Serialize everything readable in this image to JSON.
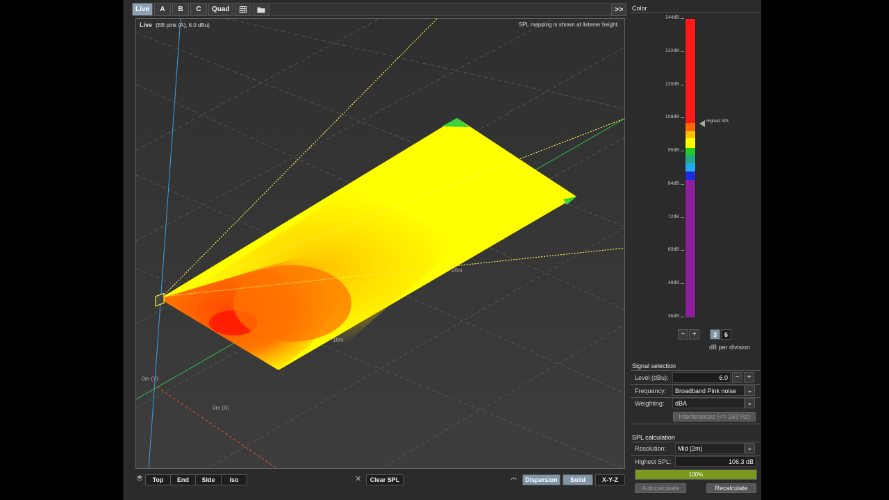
{
  "tabs": [
    {
      "label": "Live",
      "active": true
    },
    {
      "label": "A",
      "active": false
    },
    {
      "label": "B",
      "active": false
    },
    {
      "label": "C",
      "active": false
    },
    {
      "label": "Quad",
      "active": false
    }
  ],
  "toolbar": {
    "expand_label": ">>",
    "grid_icon": "table-icon",
    "folder_icon": "folder-icon"
  },
  "viewport": {
    "title": "Live",
    "signal_info": "(BB pink (A), 6.0 dBu)",
    "note": "SPL mapping is shown at listener height.",
    "axis_y_label": "0m (Y)",
    "axis_x_label": "0m (X)",
    "dist_10m": "10m",
    "dist_20m": "20m"
  },
  "bottom": {
    "views": [
      "Top",
      "End",
      "Side",
      "Iso"
    ],
    "clear_label": "Clear SPL",
    "dispersion_label": "Dispersion",
    "solid_label": "Solid",
    "xyz_label": "X-Y-Z"
  },
  "panel": {
    "color_title": "Color",
    "scale_ticks": [
      "144dB",
      "132dB",
      "120dB",
      "108dB",
      "96dB",
      "84dB",
      "72dB",
      "60dB",
      "48dB",
      "36dB"
    ],
    "highest_marker": "Highest SPL",
    "minus": "−",
    "plus": "+",
    "div_3": "3",
    "div_6": "6",
    "div_caption": "dB per division",
    "signal_title": "Signal selection",
    "level_label": "Level (dBu):",
    "level_value": "6.0",
    "frequency_label": "Frequency:",
    "frequency_value": "Broadband Pink noise",
    "weighting_label": "Weighting:",
    "weighting_value": "dBA",
    "interferences_label": "Interferences (<= 163 Hz)",
    "spl_title": "SPL calculation",
    "resolution_label": "Resolution:",
    "resolution_value": "Mid (2m)",
    "highest_label": "Highest SPL:",
    "highest_value": "106.3 dB",
    "progress_label": "100%",
    "progress_fraction": 1.0,
    "autocalc_label": "Autocalculate",
    "recalc_label": "Recalculate"
  },
  "colors": {
    "accent": "#8aa2b8",
    "progress": "#7a9a1e",
    "scale_purple": "#8e1f9c",
    "scale_red": "#ff1a1a"
  }
}
